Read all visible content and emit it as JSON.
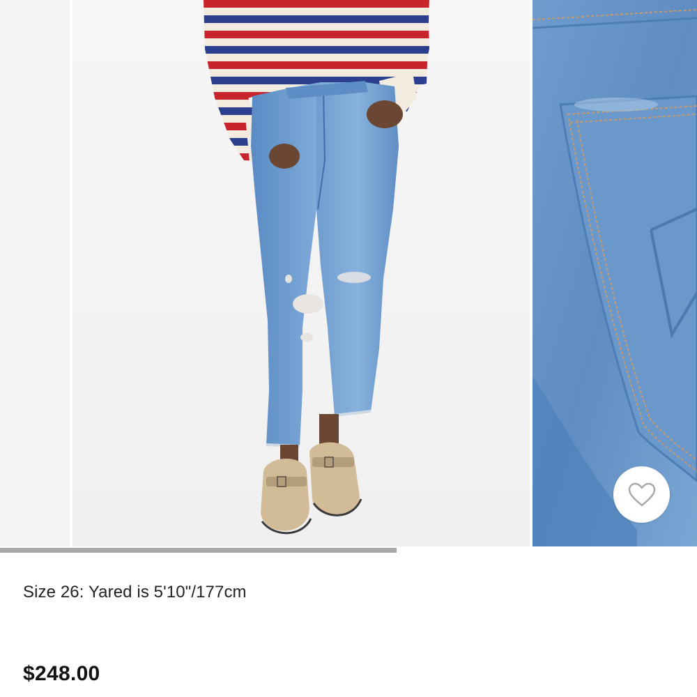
{
  "product": {
    "size_note": "Size 26: Yared is 5'10\"/177cm",
    "price": "$248.00"
  },
  "gallery": {
    "progress_fraction": 0.569,
    "images": [
      {
        "name": "previous-product-photo"
      },
      {
        "name": "main-product-photo"
      },
      {
        "name": "pocket-detail-photo"
      }
    ]
  },
  "wishlist": {
    "icon": "heart-outline-icon"
  },
  "colors": {
    "denim": "#6f9ccd",
    "denim_dark": "#4d7db5",
    "stripe_red": "#c7252b",
    "stripe_blue": "#2c3f8f",
    "stripe_cream": "#f2ece0",
    "shoe": "#d2bc98",
    "progress": "#a7a7a7"
  }
}
